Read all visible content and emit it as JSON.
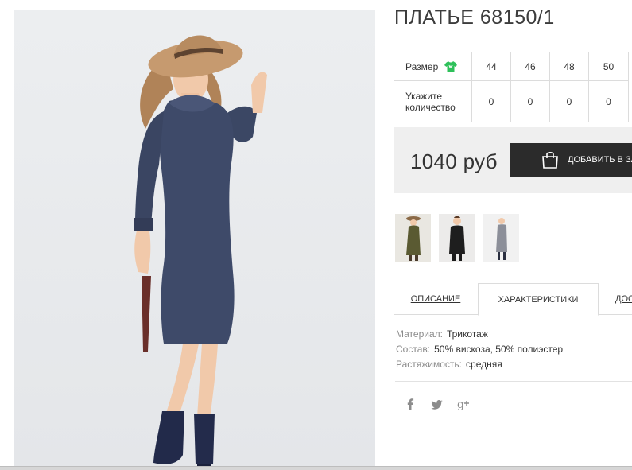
{
  "product": {
    "title": "ПЛАТЬЕ 68150/1"
  },
  "sizes": {
    "size_label": "Размер",
    "quantity_label_line1": "Укажите",
    "quantity_label_line2": "количество",
    "items": [
      {
        "size": "44",
        "quantity": "0"
      },
      {
        "size": "46",
        "quantity": "0"
      },
      {
        "size": "48",
        "quantity": "0"
      },
      {
        "size": "50",
        "quantity": "0"
      }
    ],
    "icon": "shirt-icon",
    "icon_color": "#2ec05a"
  },
  "purchase": {
    "price": "1040 руб",
    "add_button_label": "ДОБАВИТЬ В ЗАКАЗ",
    "button_icon": "shopping-bag-icon",
    "button_color": "#2b2b2b"
  },
  "thumbnails": [
    {
      "name": "olive-dress-thumbnail"
    },
    {
      "name": "black-dress-thumbnail"
    },
    {
      "name": "grey-dress-thumbnail"
    }
  ],
  "tabs": [
    {
      "label": "ОПИСАНИЕ",
      "active": false
    },
    {
      "label": "ХАРАКТЕРИСТИКИ",
      "active": true
    },
    {
      "label": "ДОСТАВКА",
      "active": false
    }
  ],
  "specs": [
    {
      "key": "Материал:",
      "value": "Трикотаж"
    },
    {
      "key": "Состав:",
      "value": "50% вискоза, 50% полиэстер"
    },
    {
      "key": "Растяжимость:",
      "value": "средняя"
    }
  ],
  "social": [
    "facebook-icon",
    "twitter-icon",
    "google-plus-icon"
  ]
}
